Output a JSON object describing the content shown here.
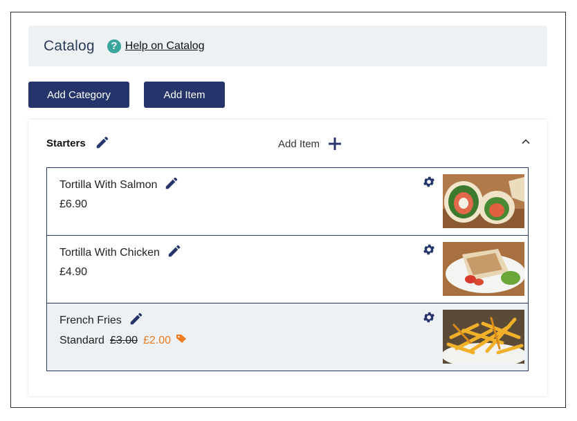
{
  "header": {
    "title": "Catalog",
    "help_link": "Help on Catalog"
  },
  "toolbar": {
    "add_category_label": "Add Category",
    "add_item_label": "Add Item"
  },
  "category": {
    "name": "Starters",
    "add_item_label": "Add Item",
    "items": [
      {
        "name": "Tortilla With Salmon",
        "price": "£6.90",
        "image": "salmon-wrap-photo"
      },
      {
        "name": "Tortilla With Chicken",
        "price": "£4.90",
        "image": "chicken-wrap-photo"
      },
      {
        "name": "French Fries",
        "variant": "Standard",
        "old_price": "£3.00",
        "new_price": "£2.00",
        "image": "french-fries-photo"
      }
    ]
  },
  "colors": {
    "primary": "#25346b",
    "header_bg": "#edf1f4",
    "help_icon": "#3aa59b",
    "sale_price": "#f07a1e"
  }
}
